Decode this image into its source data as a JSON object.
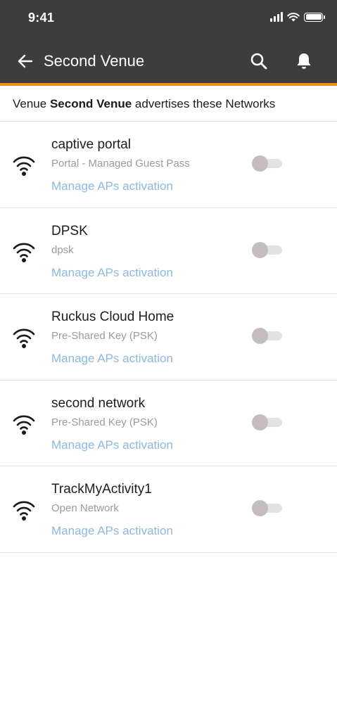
{
  "status_bar": {
    "time": "9:41"
  },
  "app_bar": {
    "title": "Second Venue"
  },
  "caption": {
    "prefix": "Venue",
    "venue_name": "Second Venue",
    "suffix": "advertises these Networks"
  },
  "networks": [
    {
      "name": "captive portal",
      "type": "Portal - Managed Guest Pass",
      "link": "Manage APs activation",
      "enabled": false
    },
    {
      "name": "DPSK",
      "type": "dpsk",
      "link": "Manage APs activation",
      "enabled": false
    },
    {
      "name": "Ruckus Cloud Home",
      "type": "Pre-Shared Key (PSK)",
      "link": "Manage APs activation",
      "enabled": false
    },
    {
      "name": "second network",
      "type": "Pre-Shared Key (PSK)",
      "link": "Manage APs activation",
      "enabled": false
    },
    {
      "name": "TrackMyActivity1",
      "type": "Open Network",
      "link": "Manage APs activation",
      "enabled": false
    }
  ],
  "icons": {
    "back": "arrow-left-icon",
    "search": "search-icon",
    "notifications": "bell-icon",
    "network": "wifi-icon"
  },
  "colors": {
    "header_bg": "#3d3d3d",
    "accent": "#f28a16",
    "link": "#8db8dd",
    "secondary_text": "#9b9b9b"
  }
}
